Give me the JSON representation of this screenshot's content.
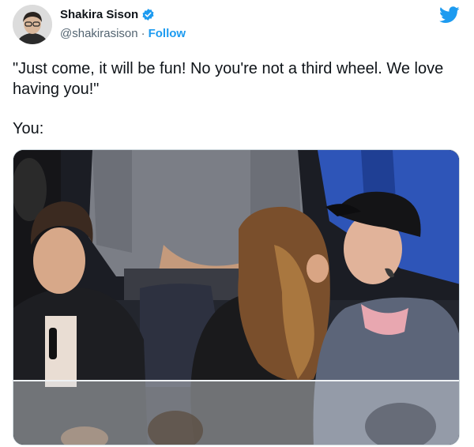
{
  "author": {
    "display_name": "Shakira Sison",
    "handle": "@shakirasison",
    "separator": "·",
    "follow_label": "Follow",
    "verified": true
  },
  "tweet": {
    "text": "\"Just come, it will be fun! No you're not a third wheel. We love having you!\"",
    "you_label": "You:"
  },
  "icons": {
    "verified": "verified-badge-icon",
    "brand": "twitter-bird-icon"
  },
  "colors": {
    "accent": "#1d9bf0",
    "secondary_text": "#536471",
    "primary_text": "#0f1419"
  }
}
